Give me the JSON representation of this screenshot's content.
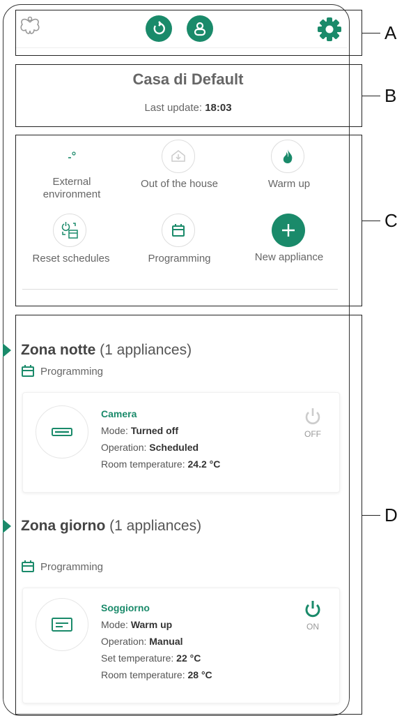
{
  "header": {
    "logo_icon": "leaf-logo-icon",
    "sync_icon": "refresh-icon",
    "user_icon": "user-icon",
    "settings_icon": "gear-icon",
    "accent": "#1a8a6a"
  },
  "home": {
    "title": "Casa di Default",
    "update_label": "Last update:",
    "update_time": "18:03"
  },
  "quick_actions": [
    {
      "label_line1": "External",
      "label_line2": "environment",
      "icon": "external-environment-icon"
    },
    {
      "label_line1": "Out of the house",
      "label_line2": "",
      "icon": "house-exit-icon"
    },
    {
      "label_line1": "Warm up",
      "label_line2": "",
      "icon": "flame-icon"
    },
    {
      "label_line1": "Reset schedules",
      "label_line2": "",
      "icon": "reset-schedule-icon"
    },
    {
      "label_line1": "Programming",
      "label_line2": "",
      "icon": "calendar-icon"
    },
    {
      "label_line1": "New appliance",
      "label_line2": "",
      "icon": "plus-icon"
    }
  ],
  "zones": [
    {
      "name": "Zona notte",
      "count": "(1 appliances)",
      "mode": "Programming",
      "device": {
        "name": "Camera",
        "mode_label": "Mode:",
        "mode_value": "Turned off",
        "op_label": "Operation:",
        "op_value": "Scheduled",
        "set_label": "",
        "set_value": "",
        "room_label": "Room temperature:",
        "room_value": "24.2 °C",
        "power_state": "OFF"
      }
    },
    {
      "name": "Zona giorno",
      "count": "(1 appliances)",
      "mode": "Programming",
      "device": {
        "name": "Soggiorno",
        "mode_label": "Mode:",
        "mode_value": "Warm up",
        "op_label": "Operation:",
        "op_value": "Manual",
        "set_label": "Set temperature:",
        "set_value": "22 °C",
        "room_label": "Room temperature:",
        "room_value": "28 °C",
        "power_state": "ON"
      }
    }
  ],
  "callouts": [
    "A",
    "B",
    "C",
    "D"
  ]
}
